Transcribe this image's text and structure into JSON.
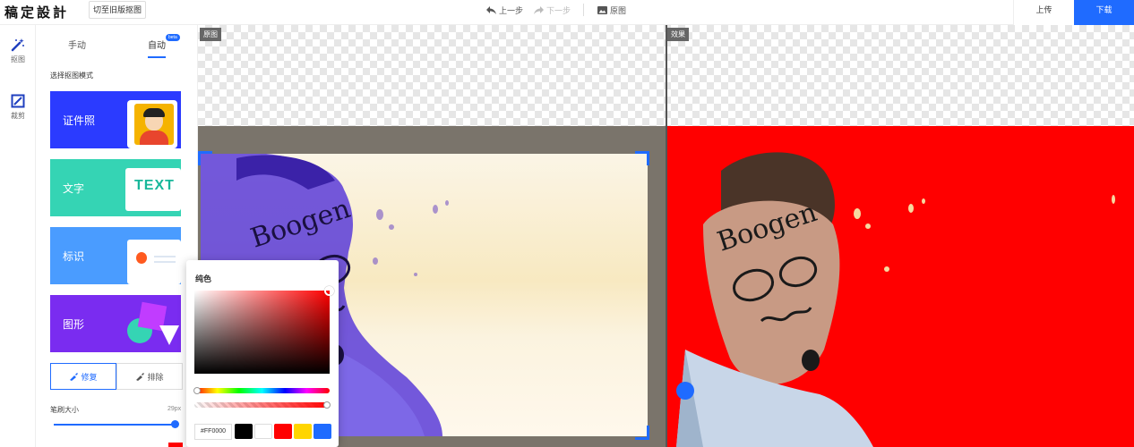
{
  "header": {
    "logo": "稿定設計",
    "old_version_button": "切至旧版抠图",
    "undo": "上一步",
    "redo": "下一步",
    "original": "原图",
    "upload": "上传",
    "download": "下载"
  },
  "rail": {
    "items": [
      {
        "label": "抠图",
        "icon": "magic-wand-icon"
      },
      {
        "label": "裁剪",
        "icon": "crop-icon"
      }
    ]
  },
  "panel": {
    "tabs": [
      "手动",
      "自动"
    ],
    "active_tab": "自动",
    "badge": "beta",
    "section_title": "选择抠图模式",
    "modes": [
      {
        "label": "证件照",
        "color": "#2b3bff"
      },
      {
        "label": "文字",
        "color": "#35d4b4",
        "preview_text": "TEXT"
      },
      {
        "label": "标识",
        "color": "#4a9cff"
      },
      {
        "label": "图形",
        "color": "#7a2cf0"
      }
    ],
    "repair": "修复",
    "erase": "排除",
    "brush_label": "笔刷大小",
    "brush_value": "29px",
    "brush_level": 1.0
  },
  "canvas": {
    "original_tag": "原图",
    "effect_tag": "效果",
    "face_text": "Boogen",
    "effect_background": "#ff0000"
  },
  "picker": {
    "title": "纯色",
    "hex": "#FF0000",
    "swatches": [
      "#000000",
      "#ffffff",
      "#ff0000",
      "#ffd500",
      "#1f6bff"
    ]
  }
}
